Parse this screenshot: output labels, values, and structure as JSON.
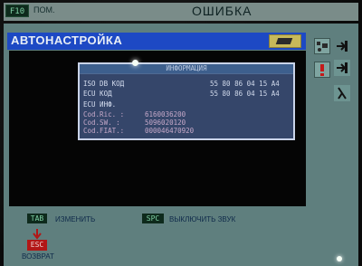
{
  "topbar": {
    "f10_key": "F10",
    "f10_label": "ПОМ.",
    "title": "ОШИБКА"
  },
  "window": {
    "title": "АВТОНАСТРОЙКА",
    "title_button_icon": "chip-icon"
  },
  "info": {
    "header": "ИНФОРМАЦИЯ",
    "rows": [
      {
        "label": "ISO DB КОД",
        "value": "55 80 86 04 15 A4"
      },
      {
        "label": "ECU КОД",
        "value": "55 80 86 04 15 A4"
      },
      {
        "label": "ECU ИНФ.",
        "value": ""
      },
      {
        "label": "Cod.Ric. :",
        "value": "6160036200"
      },
      {
        "label": "Cod.SW.  :",
        "value": "5096020120"
      },
      {
        "label": "Cod.FIAT.:",
        "value": "000046470920"
      }
    ]
  },
  "sidebar": {
    "icons": [
      "car-fault-icon",
      "exit-arrow-icon",
      "alert-icon",
      "exit-arrow-icon",
      "lambda-icon"
    ]
  },
  "bottom": {
    "tab_key": "TAB",
    "tab_label": "ИЗМЕНИТЬ",
    "spc_key": "SPC",
    "spc_label": "ВЫКЛЮЧИТЬ ЗВУК",
    "esc_key": "ESC",
    "esc_label": "ВОЗВРАТ"
  },
  "colors": {
    "title_bar": "#1d49c4",
    "screen_bg": "#5f7f7e",
    "esc_key": "#b21616",
    "key_green": "#0e2a1c"
  }
}
